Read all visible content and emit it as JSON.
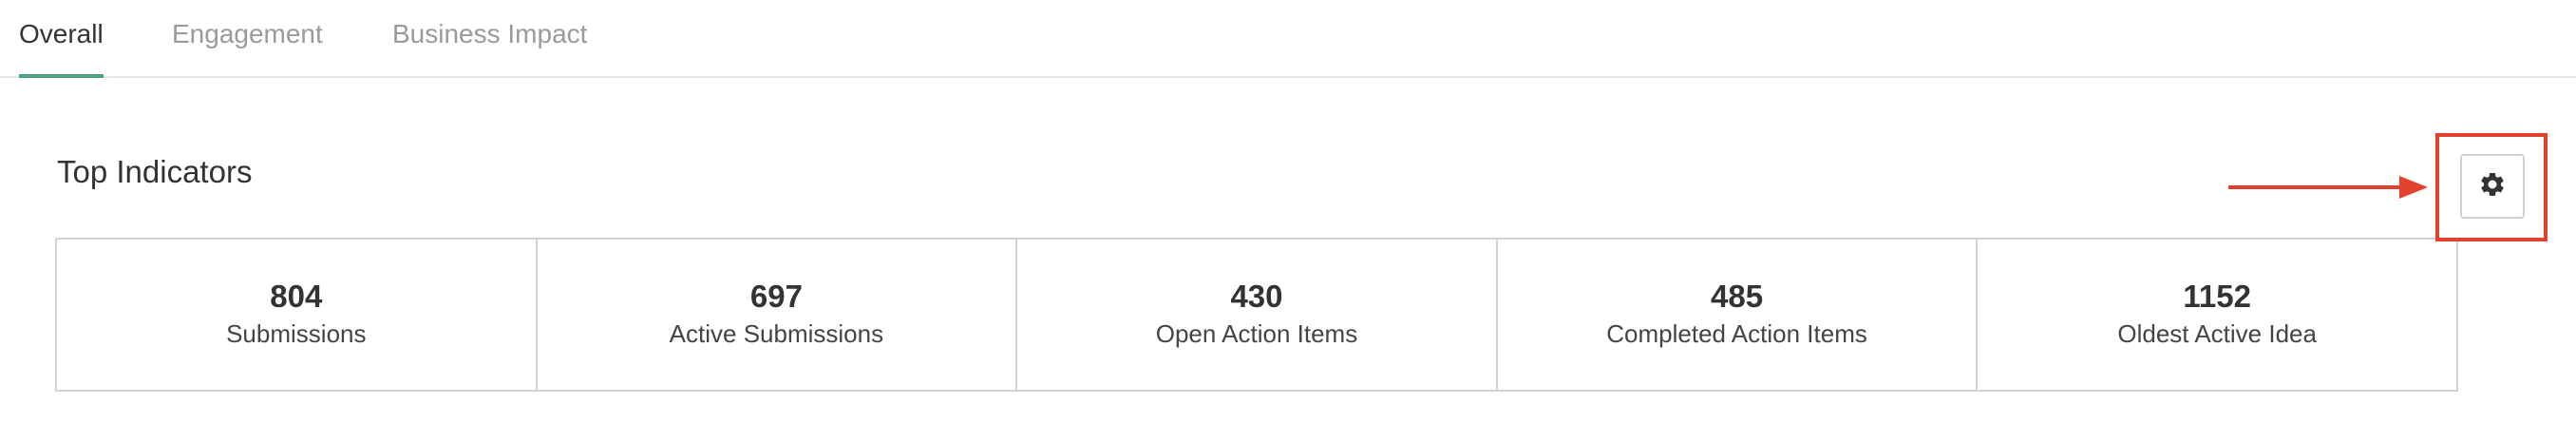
{
  "tabs": [
    {
      "label": "Overall",
      "active": true
    },
    {
      "label": "Engagement",
      "active": false
    },
    {
      "label": "Business Impact",
      "active": false
    }
  ],
  "section": {
    "title": "Top Indicators"
  },
  "indicators": [
    {
      "value": "804",
      "label": "Submissions"
    },
    {
      "value": "697",
      "label": "Active Submissions"
    },
    {
      "value": "430",
      "label": "Open Action Items"
    },
    {
      "value": "485",
      "label": "Completed Action Items"
    },
    {
      "value": "1152",
      "label": "Oldest Active Idea"
    }
  ],
  "settings_button": {
    "icon": "gear-icon"
  },
  "colors": {
    "active_tab_underline": "#4f9f7b",
    "annotation_red": "#e2412b"
  }
}
